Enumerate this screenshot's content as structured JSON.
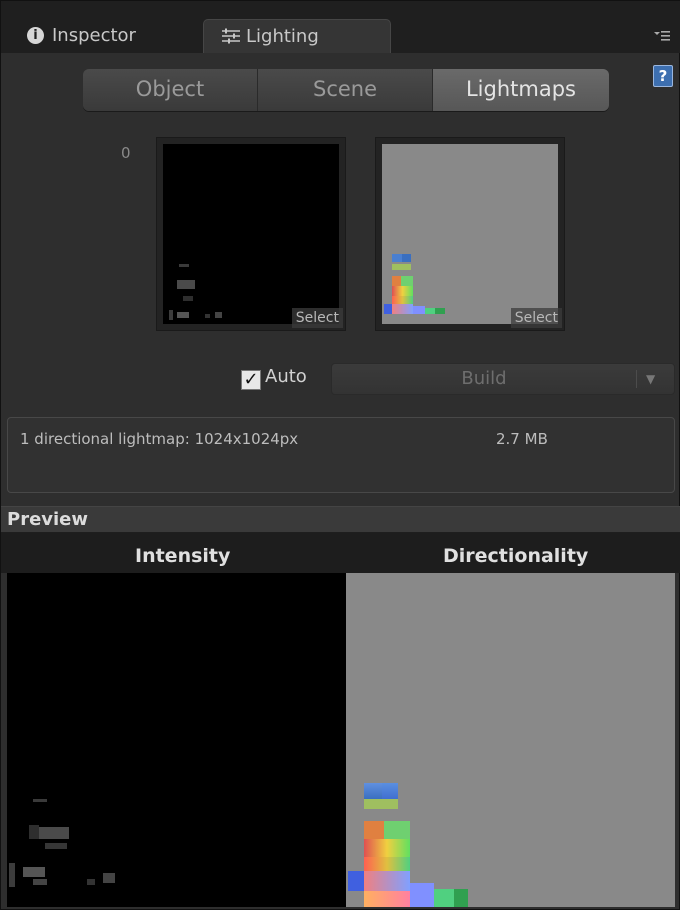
{
  "tabs": {
    "inspector_label": "Inspector",
    "lighting_label": "Lighting"
  },
  "segmented": {
    "object": "Object",
    "scene": "Scene",
    "lightmaps": "Lightmaps",
    "active": "Lightmaps"
  },
  "lightmaps": {
    "index": "0",
    "intensity_select": "Select",
    "directionality_select": "Select"
  },
  "bake": {
    "auto_label": "Auto",
    "auto_checked": true,
    "build_label": "Build"
  },
  "info": {
    "description": "1 directional lightmap: 1024x1024px",
    "size": "2.7 MB"
  },
  "preview": {
    "title": "Preview",
    "intensity_title": "Intensity",
    "directionality_title": "Directionality"
  },
  "icons": {
    "info": "info-icon",
    "lighting": "sliders-icon",
    "menu": "menu-icon",
    "help": "help-icon",
    "checkbox": "check-icon",
    "dropdown": "chevron-down-icon"
  },
  "colors": {
    "background": "#2e2e2e",
    "tabbar": "#1f1f1f",
    "active_segment": "#5e5e5e",
    "directional_gray": "#898989",
    "help_blue": "#3d6fb0"
  }
}
